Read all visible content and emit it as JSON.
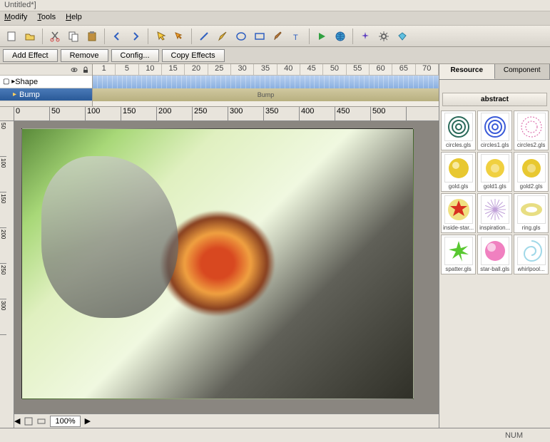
{
  "title": "Untitled*]",
  "menu": [
    "Modify",
    "Tools",
    "Help"
  ],
  "toolbar_icons": [
    "new",
    "open",
    "cut",
    "copy",
    "paste",
    "back",
    "forward",
    "pointer",
    "move",
    "line",
    "pen",
    "oval",
    "rect",
    "brush",
    "text",
    "play",
    "globe",
    "sparkle",
    "gear",
    "diamond"
  ],
  "effects_bar": {
    "add": "Add Effect",
    "remove": "Remove",
    "config": "Config...",
    "copy": "Copy Effects"
  },
  "timeline": {
    "shape_label": "Shape",
    "bump_label": "Bump",
    "ticks": [
      "1",
      "5",
      "10",
      "15",
      "20",
      "25",
      "30",
      "35",
      "40",
      "45",
      "50",
      "55",
      "60",
      "65",
      "70"
    ],
    "bump_track_label": "Bump"
  },
  "ruler_h": [
    "0",
    "50",
    "100",
    "150",
    "200",
    "250",
    "300",
    "350",
    "400",
    "450",
    "500"
  ],
  "ruler_v": [
    "50",
    "100",
    "150",
    "200",
    "250",
    "300"
  ],
  "zoom": "100%",
  "right": {
    "tabs": [
      "Resource",
      "Component"
    ],
    "category": "abstract",
    "thumbs": [
      {
        "name": "circles.gls",
        "color": "#2a6a5a",
        "shape": "rings"
      },
      {
        "name": "circles1.gls",
        "color": "#3a5ad8",
        "shape": "rings"
      },
      {
        "name": "circles2.gls",
        "color": "#d85aa0",
        "shape": "dots"
      },
      {
        "name": "gold.gls",
        "color": "#e8c830",
        "shape": "disc"
      },
      {
        "name": "gold1.gls",
        "color": "#f0d040",
        "shape": "ring"
      },
      {
        "name": "gold2.gls",
        "color": "#e8c830",
        "shape": "ring"
      },
      {
        "name": "inside-star...",
        "color": "#d83020",
        "shape": "star"
      },
      {
        "name": "inspiration...",
        "color": "#c0a0d8",
        "shape": "burst"
      },
      {
        "name": "ring.gls",
        "color": "#d8c830",
        "shape": "oval"
      },
      {
        "name": "spatter.gls",
        "color": "#58c830",
        "shape": "splat"
      },
      {
        "name": "star-ball.gls",
        "color": "#f080c0",
        "shape": "ball"
      },
      {
        "name": "whirlpool...",
        "color": "#a0d8e8",
        "shape": "swirl"
      }
    ]
  },
  "status": {
    "num": "NUM"
  }
}
